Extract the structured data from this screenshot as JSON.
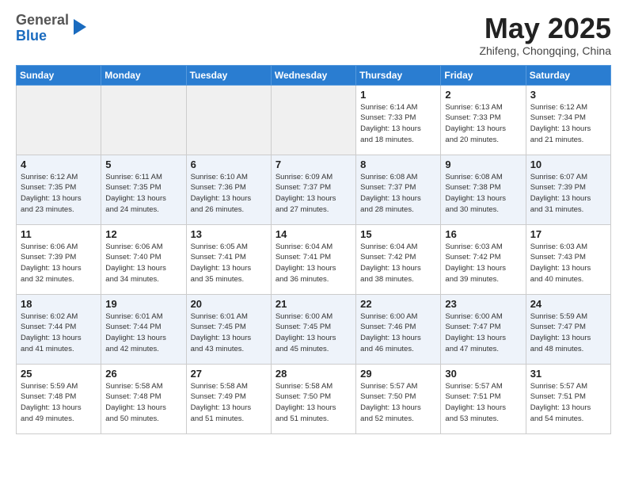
{
  "header": {
    "logo_line1": "General",
    "logo_line2": "Blue",
    "month": "May 2025",
    "location": "Zhifeng, Chongqing, China"
  },
  "weekdays": [
    "Sunday",
    "Monday",
    "Tuesday",
    "Wednesday",
    "Thursday",
    "Friday",
    "Saturday"
  ],
  "weeks": [
    [
      {
        "day": "",
        "info": ""
      },
      {
        "day": "",
        "info": ""
      },
      {
        "day": "",
        "info": ""
      },
      {
        "day": "",
        "info": ""
      },
      {
        "day": "1",
        "info": "Sunrise: 6:14 AM\nSunset: 7:33 PM\nDaylight: 13 hours\nand 18 minutes."
      },
      {
        "day": "2",
        "info": "Sunrise: 6:13 AM\nSunset: 7:33 PM\nDaylight: 13 hours\nand 20 minutes."
      },
      {
        "day": "3",
        "info": "Sunrise: 6:12 AM\nSunset: 7:34 PM\nDaylight: 13 hours\nand 21 minutes."
      }
    ],
    [
      {
        "day": "4",
        "info": "Sunrise: 6:12 AM\nSunset: 7:35 PM\nDaylight: 13 hours\nand 23 minutes."
      },
      {
        "day": "5",
        "info": "Sunrise: 6:11 AM\nSunset: 7:35 PM\nDaylight: 13 hours\nand 24 minutes."
      },
      {
        "day": "6",
        "info": "Sunrise: 6:10 AM\nSunset: 7:36 PM\nDaylight: 13 hours\nand 26 minutes."
      },
      {
        "day": "7",
        "info": "Sunrise: 6:09 AM\nSunset: 7:37 PM\nDaylight: 13 hours\nand 27 minutes."
      },
      {
        "day": "8",
        "info": "Sunrise: 6:08 AM\nSunset: 7:37 PM\nDaylight: 13 hours\nand 28 minutes."
      },
      {
        "day": "9",
        "info": "Sunrise: 6:08 AM\nSunset: 7:38 PM\nDaylight: 13 hours\nand 30 minutes."
      },
      {
        "day": "10",
        "info": "Sunrise: 6:07 AM\nSunset: 7:39 PM\nDaylight: 13 hours\nand 31 minutes."
      }
    ],
    [
      {
        "day": "11",
        "info": "Sunrise: 6:06 AM\nSunset: 7:39 PM\nDaylight: 13 hours\nand 32 minutes."
      },
      {
        "day": "12",
        "info": "Sunrise: 6:06 AM\nSunset: 7:40 PM\nDaylight: 13 hours\nand 34 minutes."
      },
      {
        "day": "13",
        "info": "Sunrise: 6:05 AM\nSunset: 7:41 PM\nDaylight: 13 hours\nand 35 minutes."
      },
      {
        "day": "14",
        "info": "Sunrise: 6:04 AM\nSunset: 7:41 PM\nDaylight: 13 hours\nand 36 minutes."
      },
      {
        "day": "15",
        "info": "Sunrise: 6:04 AM\nSunset: 7:42 PM\nDaylight: 13 hours\nand 38 minutes."
      },
      {
        "day": "16",
        "info": "Sunrise: 6:03 AM\nSunset: 7:42 PM\nDaylight: 13 hours\nand 39 minutes."
      },
      {
        "day": "17",
        "info": "Sunrise: 6:03 AM\nSunset: 7:43 PM\nDaylight: 13 hours\nand 40 minutes."
      }
    ],
    [
      {
        "day": "18",
        "info": "Sunrise: 6:02 AM\nSunset: 7:44 PM\nDaylight: 13 hours\nand 41 minutes."
      },
      {
        "day": "19",
        "info": "Sunrise: 6:01 AM\nSunset: 7:44 PM\nDaylight: 13 hours\nand 42 minutes."
      },
      {
        "day": "20",
        "info": "Sunrise: 6:01 AM\nSunset: 7:45 PM\nDaylight: 13 hours\nand 43 minutes."
      },
      {
        "day": "21",
        "info": "Sunrise: 6:00 AM\nSunset: 7:45 PM\nDaylight: 13 hours\nand 45 minutes."
      },
      {
        "day": "22",
        "info": "Sunrise: 6:00 AM\nSunset: 7:46 PM\nDaylight: 13 hours\nand 46 minutes."
      },
      {
        "day": "23",
        "info": "Sunrise: 6:00 AM\nSunset: 7:47 PM\nDaylight: 13 hours\nand 47 minutes."
      },
      {
        "day": "24",
        "info": "Sunrise: 5:59 AM\nSunset: 7:47 PM\nDaylight: 13 hours\nand 48 minutes."
      }
    ],
    [
      {
        "day": "25",
        "info": "Sunrise: 5:59 AM\nSunset: 7:48 PM\nDaylight: 13 hours\nand 49 minutes."
      },
      {
        "day": "26",
        "info": "Sunrise: 5:58 AM\nSunset: 7:48 PM\nDaylight: 13 hours\nand 50 minutes."
      },
      {
        "day": "27",
        "info": "Sunrise: 5:58 AM\nSunset: 7:49 PM\nDaylight: 13 hours\nand 51 minutes."
      },
      {
        "day": "28",
        "info": "Sunrise: 5:58 AM\nSunset: 7:50 PM\nDaylight: 13 hours\nand 51 minutes."
      },
      {
        "day": "29",
        "info": "Sunrise: 5:57 AM\nSunset: 7:50 PM\nDaylight: 13 hours\nand 52 minutes."
      },
      {
        "day": "30",
        "info": "Sunrise: 5:57 AM\nSunset: 7:51 PM\nDaylight: 13 hours\nand 53 minutes."
      },
      {
        "day": "31",
        "info": "Sunrise: 5:57 AM\nSunset: 7:51 PM\nDaylight: 13 hours\nand 54 minutes."
      }
    ]
  ]
}
